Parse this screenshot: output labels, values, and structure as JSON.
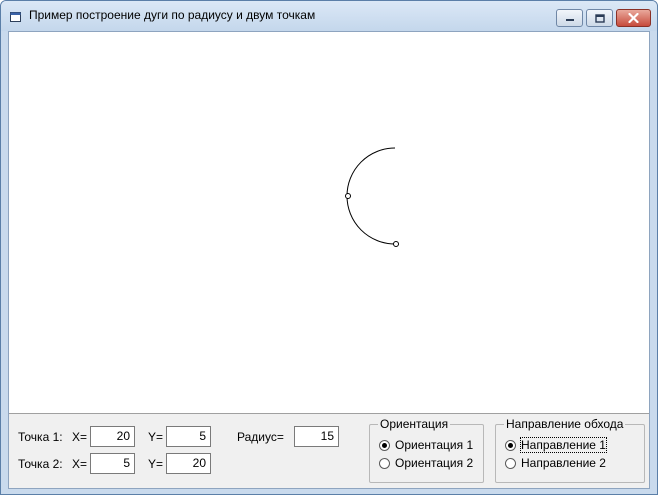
{
  "window": {
    "title": "Пример построение дуги по радиусу и двум точкам"
  },
  "point1": {
    "label": "Точка 1:",
    "x_label": "X=",
    "x_value": "20",
    "y_label": "Y=",
    "y_value": "5"
  },
  "point2": {
    "label": "Точка 2:",
    "x_label": "X=",
    "x_value": "5",
    "y_label": "Y=",
    "y_value": "20"
  },
  "radius": {
    "label": "Радиус=",
    "value": "15"
  },
  "orientation": {
    "title": "Ориентация",
    "options": [
      {
        "label": "Ориентация 1",
        "selected": true
      },
      {
        "label": "Ориентация 2",
        "selected": false
      }
    ]
  },
  "direction": {
    "title": "Направление обхода",
    "options": [
      {
        "label": "Направление 1",
        "selected": true
      },
      {
        "label": "Направление 2",
        "selected": false
      }
    ]
  },
  "colors": {
    "arc": "#000000",
    "canvas_background": "#ffffff",
    "panel_background": "#f0f0f0"
  },
  "icons": [
    "app-window-icon",
    "minimize-icon",
    "maximize-icon",
    "close-icon"
  ]
}
